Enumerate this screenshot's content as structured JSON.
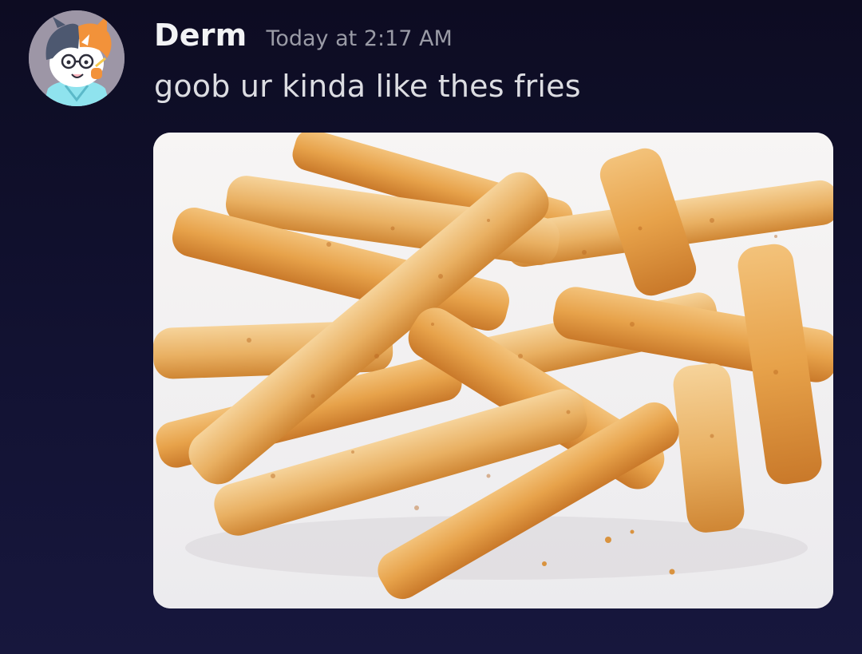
{
  "message": {
    "author": "Derm",
    "timestamp": "Today at 2:17 AM",
    "text": "goob ur kinda like thes fries",
    "avatar_icon": "cartoon-character-avatar",
    "attachment_icon": "french-fries-photo"
  },
  "colors": {
    "background": "#121232",
    "username": "#f2f3f5",
    "timestamp": "#9a9ba6",
    "text": "#dcdde2"
  }
}
